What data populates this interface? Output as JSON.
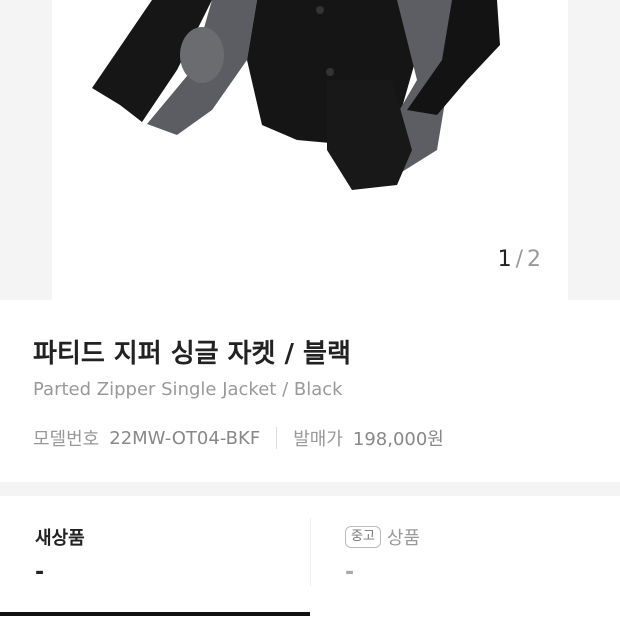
{
  "gallery": {
    "current": "1",
    "separator": "/",
    "total": "2"
  },
  "product": {
    "title_ko": "파티드 지퍼 싱글 자켓 / 블랙",
    "title_en": "Parted Zipper Single Jacket / Black",
    "model_label": "모델번호",
    "model_value": "22MW-OT04-BKF",
    "release_label": "발매가",
    "release_value": "198,000원"
  },
  "condition_tabs": {
    "new": {
      "label": "새상품",
      "value": "-"
    },
    "used": {
      "badge": "중고",
      "label": "상품",
      "value": "-"
    }
  },
  "colors": {
    "text_primary": "#222222",
    "text_secondary": "#999999",
    "background_alt": "#f4f4f4",
    "indicator": "#111111"
  }
}
